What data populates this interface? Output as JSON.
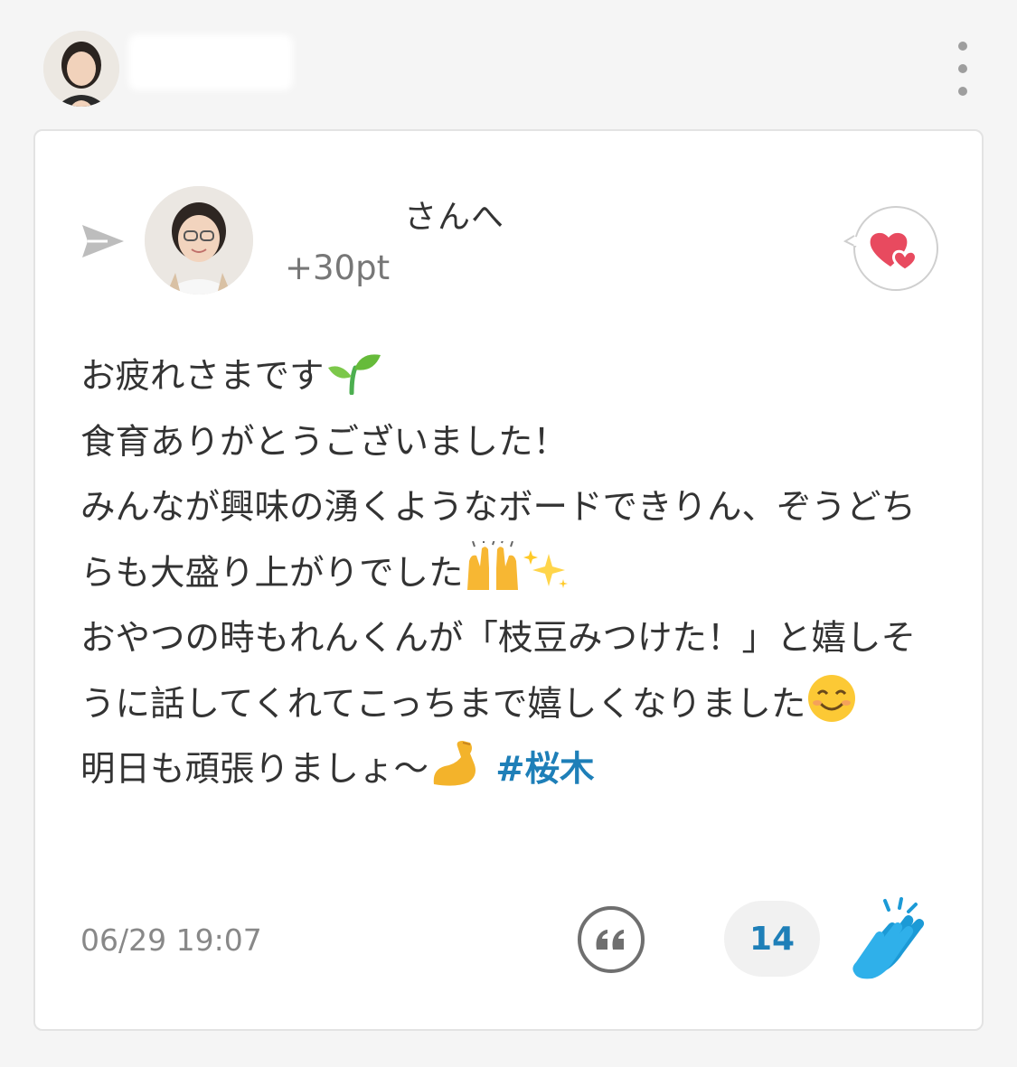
{
  "header": {
    "avatar_icon": "sender-avatar",
    "menu_icon": "more-vertical-icon"
  },
  "card": {
    "send_icon": "send-arrow-icon",
    "recipient_avatar_icon": "recipient-avatar",
    "recipient_suffix": "さんへ",
    "points": "+30pt",
    "reaction_icon": "heart-bubble-icon",
    "message": {
      "line1": "お疲れさまです",
      "line2": "食育ありがとうございました！",
      "line3": "みんなが興味の湧くようなボードできりん、ぞうどちらも大盛り上がりでした",
      "line4": "おやつの時もれんくんが「枝豆みつけた！」と嬉しそうに話してくれてこっちまで嬉しくなりました",
      "line5": "明日も頑張りましょ〜",
      "hashtag": "#桜木"
    },
    "timestamp": "06/29 19:07",
    "quote_icon": "quote-icon",
    "clap_count": "14",
    "clap_icon": "clapping-hands-icon"
  },
  "colors": {
    "accent": "#1e7fb8",
    "heart": "#e84a5f",
    "clap": "#1c9ad6",
    "text": "#333333",
    "muted": "#888888"
  }
}
